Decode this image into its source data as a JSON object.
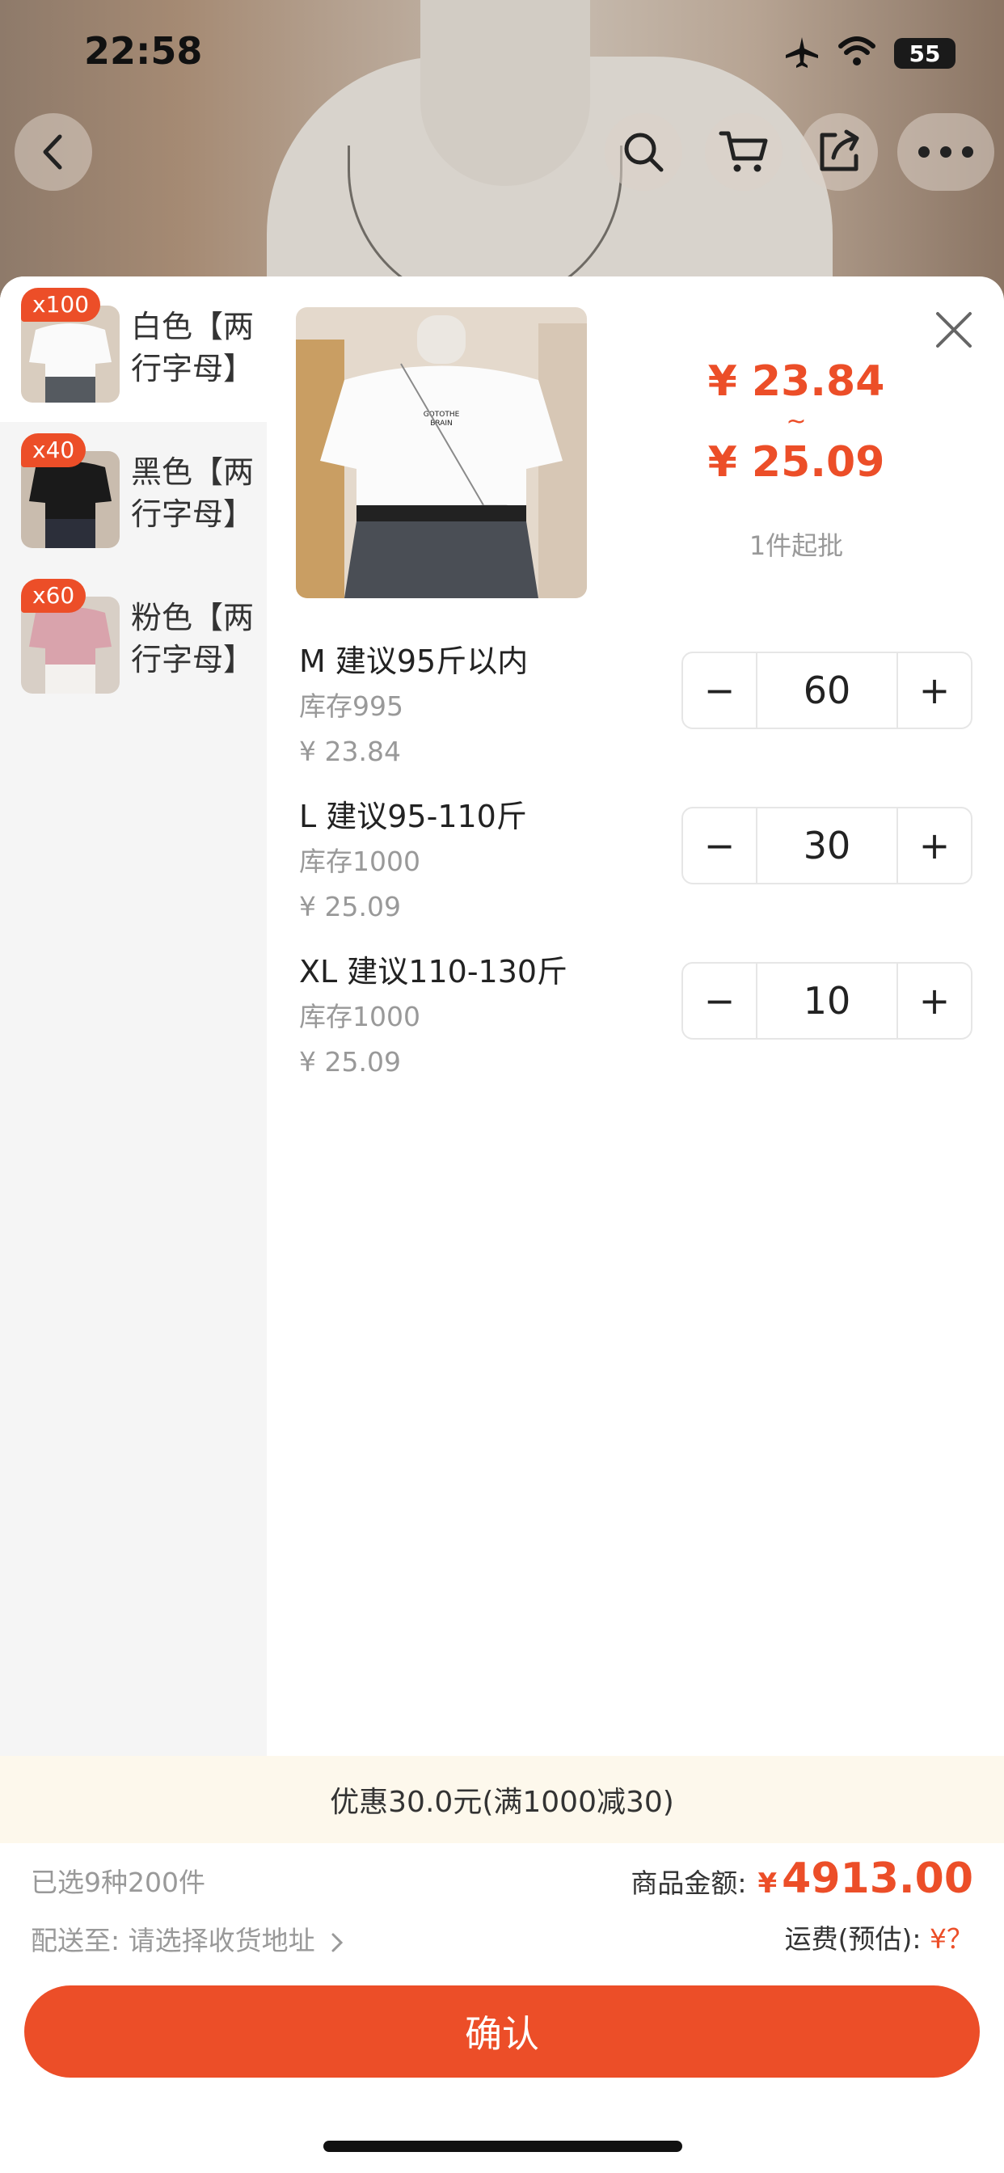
{
  "status": {
    "time": "22:58",
    "battery": "55"
  },
  "variants": [
    {
      "badge": "x100",
      "label": "白色【两行字母】",
      "active": true
    },
    {
      "badge": "x40",
      "label": "黑色【两行字母】",
      "active": false
    },
    {
      "badge": "x60",
      "label": "粉色【两行字母】",
      "active": false
    }
  ],
  "price": {
    "low": "¥ 23.84",
    "tilde": "~",
    "high": "¥ 25.09",
    "min_order": "1件起批"
  },
  "sizes": [
    {
      "name": "M 建议95斤以内",
      "stock": "库存995",
      "price": "¥ 23.84",
      "qty": "60"
    },
    {
      "name": "L 建议95-110斤",
      "stock": "库存1000",
      "price": "¥ 25.09",
      "qty": "30"
    },
    {
      "name": "XL 建议110-130斤",
      "stock": "库存1000",
      "price": "¥ 25.09",
      "qty": "10"
    }
  ],
  "stepper": {
    "minus": "−",
    "plus": "+"
  },
  "promo": "优惠30.0元(满1000减30)",
  "summary": {
    "selected": "已选9种200件",
    "ship_to_label": "配送至:",
    "ship_to_value": "请选择收货地址",
    "total_label": "商品金额:",
    "total_currency": "¥",
    "total_value": "4913.00",
    "shipping_label": "运费(预估):",
    "shipping_value": "¥？"
  },
  "confirm_label": "确认",
  "product_image_text": [
    "GOTOTHE",
    "BRAIN"
  ],
  "colors": {
    "accent": "#ec4e28",
    "promo_bg": "#fdf8ec",
    "sidebar_bg": "#f5f5f5"
  },
  "icons": [
    "back-icon",
    "search-icon",
    "cart-icon",
    "share-icon",
    "more-icon",
    "close-icon",
    "airplane-icon",
    "wifi-icon",
    "chevron-right-icon"
  ]
}
